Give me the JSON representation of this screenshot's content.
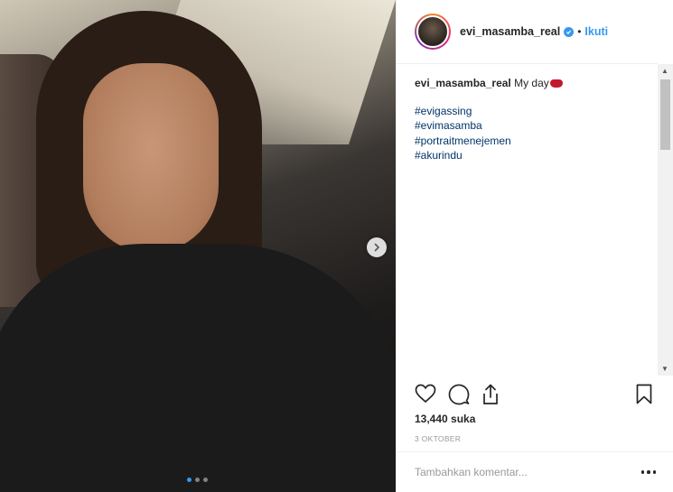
{
  "photo": {
    "carousel_dots": 3,
    "active_dot": 0
  },
  "header": {
    "username": "evi_masamba_real",
    "separator": "•",
    "follow_label": "Ikuti"
  },
  "caption": {
    "username": "evi_masamba_real",
    "text": "My day",
    "hashtags": [
      "#evigassing",
      "#evimasamba",
      "#portraitmenejemen",
      "#akurindu"
    ]
  },
  "stats": {
    "likes": "13,440 suka",
    "date": "3 OKTOBER"
  },
  "comment": {
    "placeholder": "Tambahkan komentar..."
  },
  "icons": {
    "like": "heart-icon",
    "comment": "comment-icon",
    "share": "share-icon",
    "save": "bookmark-icon",
    "next": "chevron-right-icon",
    "more": "more-options-icon",
    "verified": "verified-badge-icon"
  },
  "colors": {
    "accent": "#3897f0",
    "hashtag": "#003569",
    "muted": "#999999"
  }
}
